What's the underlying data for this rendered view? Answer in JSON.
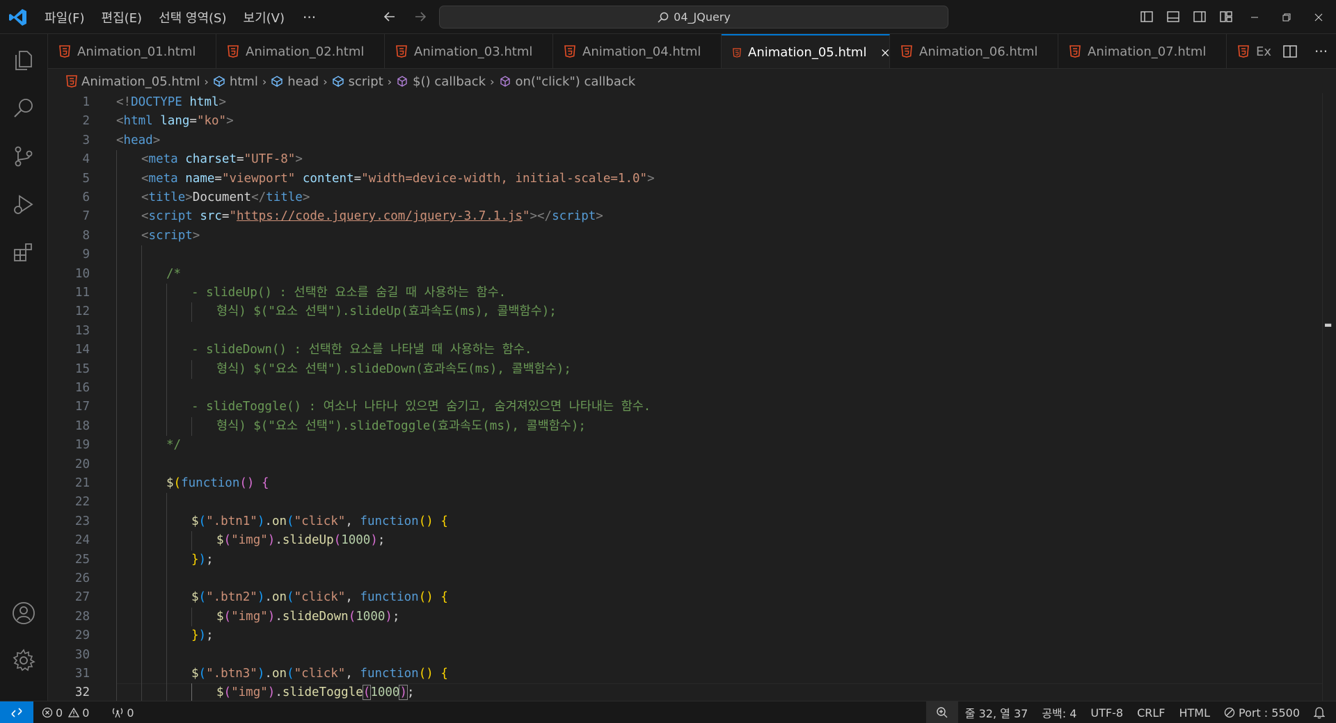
{
  "titlebar": {
    "menu": [
      "파일(F)",
      "편집(E)",
      "선택 영역(S)",
      "보기(V)"
    ],
    "more": "···",
    "search_text": "04_JQuery"
  },
  "tabs": [
    {
      "label": "Animation_01.html",
      "active": false
    },
    {
      "label": "Animation_02.html",
      "active": false
    },
    {
      "label": "Animation_03.html",
      "active": false
    },
    {
      "label": "Animation_04.html",
      "active": false
    },
    {
      "label": "Animation_05.html",
      "active": true
    },
    {
      "label": "Animation_06.html",
      "active": false
    },
    {
      "label": "Animation_07.html",
      "active": false
    }
  ],
  "tab_overflow_label": "Ex",
  "breadcrumb": [
    "Animation_05.html",
    "html",
    "head",
    "script",
    "$() callback",
    "on(\"click\") callback"
  ],
  "editor": {
    "current_line": 32,
    "lines": [
      {
        "n": 1,
        "indent": 0,
        "tokens": [
          [
            "br",
            "<!"
          ],
          [
            "tag",
            "DOCTYPE"
          ],
          [
            "txt",
            " "
          ],
          [
            "attr",
            "html"
          ],
          [
            "br",
            ">"
          ]
        ]
      },
      {
        "n": 2,
        "indent": 0,
        "tokens": [
          [
            "br",
            "<"
          ],
          [
            "tag",
            "html"
          ],
          [
            "txt",
            " "
          ],
          [
            "attr",
            "lang"
          ],
          [
            "txt",
            "="
          ],
          [
            "str",
            "\"ko\""
          ],
          [
            "br",
            ">"
          ]
        ]
      },
      {
        "n": 3,
        "indent": 0,
        "tokens": [
          [
            "br",
            "<"
          ],
          [
            "tag",
            "head"
          ],
          [
            "br",
            ">"
          ]
        ]
      },
      {
        "n": 4,
        "indent": 1,
        "tokens": [
          [
            "br",
            "<"
          ],
          [
            "tag",
            "meta"
          ],
          [
            "txt",
            " "
          ],
          [
            "attr",
            "charset"
          ],
          [
            "txt",
            "="
          ],
          [
            "str",
            "\"UTF-8\""
          ],
          [
            "br",
            ">"
          ]
        ]
      },
      {
        "n": 5,
        "indent": 1,
        "tokens": [
          [
            "br",
            "<"
          ],
          [
            "tag",
            "meta"
          ],
          [
            "txt",
            " "
          ],
          [
            "attr",
            "name"
          ],
          [
            "txt",
            "="
          ],
          [
            "str",
            "\"viewport\""
          ],
          [
            "txt",
            " "
          ],
          [
            "attr",
            "content"
          ],
          [
            "txt",
            "="
          ],
          [
            "str",
            "\"width=device-width, initial-scale=1.0\""
          ],
          [
            "br",
            ">"
          ]
        ]
      },
      {
        "n": 6,
        "indent": 1,
        "tokens": [
          [
            "br",
            "<"
          ],
          [
            "tag",
            "title"
          ],
          [
            "br",
            ">"
          ],
          [
            "txt",
            "Document"
          ],
          [
            "br",
            "</"
          ],
          [
            "tag",
            "title"
          ],
          [
            "br",
            ">"
          ]
        ]
      },
      {
        "n": 7,
        "indent": 1,
        "tokens": [
          [
            "br",
            "<"
          ],
          [
            "tag",
            "script"
          ],
          [
            "txt",
            " "
          ],
          [
            "attr",
            "src"
          ],
          [
            "txt",
            "="
          ],
          [
            "str",
            "\""
          ],
          [
            "stru",
            "https://code.jquery.com/jquery-3.7.1.js"
          ],
          [
            "str",
            "\""
          ],
          [
            "br",
            "></"
          ],
          [
            "tag",
            "script"
          ],
          [
            "br",
            ">"
          ]
        ]
      },
      {
        "n": 8,
        "indent": 1,
        "tokens": [
          [
            "br",
            "<"
          ],
          [
            "tag",
            "script"
          ],
          [
            "br",
            ">"
          ]
        ]
      },
      {
        "n": 9,
        "indent": 2,
        "tokens": []
      },
      {
        "n": 10,
        "indent": 2,
        "tokens": [
          [
            "cm",
            "/*"
          ]
        ]
      },
      {
        "n": 11,
        "indent": 3,
        "tokens": [
          [
            "cm",
            "- slideUp() : 선택한 요소를 숨길 때 사용하는 함수."
          ]
        ]
      },
      {
        "n": 12,
        "indent": 4,
        "tokens": [
          [
            "cm",
            "형식) $(\"요소 선택\").slideUp(효과속도(ms), 콜백함수);"
          ]
        ]
      },
      {
        "n": 13,
        "indent": 3,
        "tokens": []
      },
      {
        "n": 14,
        "indent": 3,
        "tokens": [
          [
            "cm",
            "- slideDown() : 선택한 요소를 나타낼 때 사용하는 함수."
          ]
        ]
      },
      {
        "n": 15,
        "indent": 4,
        "tokens": [
          [
            "cm",
            "형식) $(\"요소 선택\").slideDown(효과속도(ms), 콜백함수);"
          ]
        ]
      },
      {
        "n": 16,
        "indent": 3,
        "tokens": []
      },
      {
        "n": 17,
        "indent": 3,
        "tokens": [
          [
            "cm",
            "- slideToggle() : 여소나 나타나 있으면 숨기고, 숨겨져있으면 나타내는 함수."
          ]
        ]
      },
      {
        "n": 18,
        "indent": 4,
        "tokens": [
          [
            "cm",
            "형식) $(\"요소 선택\").slideToggle(효과속도(ms), 콜백함수);"
          ]
        ]
      },
      {
        "n": 19,
        "indent": 2,
        "tokens": [
          [
            "cm",
            "*/"
          ]
        ]
      },
      {
        "n": 20,
        "indent": 2,
        "tokens": []
      },
      {
        "n": 21,
        "indent": 2,
        "tokens": [
          [
            "fn",
            "$"
          ],
          [
            "y",
            "("
          ],
          [
            "kw",
            "function"
          ],
          [
            "p",
            "()"
          ],
          [
            "txt",
            " "
          ],
          [
            "p",
            "{"
          ]
        ]
      },
      {
        "n": 22,
        "indent": 3,
        "tokens": []
      },
      {
        "n": 23,
        "indent": 3,
        "tokens": [
          [
            "fn",
            "$"
          ],
          [
            "b",
            "("
          ],
          [
            "str",
            "\".btn1\""
          ],
          [
            "b",
            ")"
          ],
          [
            "txt",
            "."
          ],
          [
            "fn",
            "on"
          ],
          [
            "b",
            "("
          ],
          [
            "str",
            "\"click\""
          ],
          [
            "txt",
            ", "
          ],
          [
            "kw",
            "function"
          ],
          [
            "y",
            "()"
          ],
          [
            "txt",
            " "
          ],
          [
            "y",
            "{"
          ]
        ]
      },
      {
        "n": 24,
        "indent": 4,
        "tokens": [
          [
            "fn",
            "$"
          ],
          [
            "p",
            "("
          ],
          [
            "str",
            "\"img\""
          ],
          [
            "p",
            ")"
          ],
          [
            "txt",
            "."
          ],
          [
            "fn",
            "slideUp"
          ],
          [
            "p",
            "("
          ],
          [
            "num",
            "1000"
          ],
          [
            "p",
            ")"
          ],
          [
            "txt",
            ";"
          ]
        ]
      },
      {
        "n": 25,
        "indent": 3,
        "tokens": [
          [
            "y",
            "}"
          ],
          [
            "b",
            ")"
          ],
          [
            "txt",
            ";"
          ]
        ]
      },
      {
        "n": 26,
        "indent": 3,
        "tokens": []
      },
      {
        "n": 27,
        "indent": 3,
        "tokens": [
          [
            "fn",
            "$"
          ],
          [
            "b",
            "("
          ],
          [
            "str",
            "\".btn2\""
          ],
          [
            "b",
            ")"
          ],
          [
            "txt",
            "."
          ],
          [
            "fn",
            "on"
          ],
          [
            "b",
            "("
          ],
          [
            "str",
            "\"click\""
          ],
          [
            "txt",
            ", "
          ],
          [
            "kw",
            "function"
          ],
          [
            "y",
            "()"
          ],
          [
            "txt",
            " "
          ],
          [
            "y",
            "{"
          ]
        ]
      },
      {
        "n": 28,
        "indent": 4,
        "tokens": [
          [
            "fn",
            "$"
          ],
          [
            "p",
            "("
          ],
          [
            "str",
            "\"img\""
          ],
          [
            "p",
            ")"
          ],
          [
            "txt",
            "."
          ],
          [
            "fn",
            "slideDown"
          ],
          [
            "p",
            "("
          ],
          [
            "num",
            "1000"
          ],
          [
            "p",
            ")"
          ],
          [
            "txt",
            ";"
          ]
        ]
      },
      {
        "n": 29,
        "indent": 3,
        "tokens": [
          [
            "y",
            "}"
          ],
          [
            "b",
            ")"
          ],
          [
            "txt",
            ";"
          ]
        ]
      },
      {
        "n": 30,
        "indent": 3,
        "tokens": []
      },
      {
        "n": 31,
        "indent": 3,
        "tokens": [
          [
            "fn",
            "$"
          ],
          [
            "b",
            "("
          ],
          [
            "str",
            "\".btn3\""
          ],
          [
            "b",
            ")"
          ],
          [
            "txt",
            "."
          ],
          [
            "fn",
            "on"
          ],
          [
            "b",
            "("
          ],
          [
            "str",
            "\"click\""
          ],
          [
            "txt",
            ", "
          ],
          [
            "kw",
            "function"
          ],
          [
            "y",
            "()"
          ],
          [
            "txt",
            " "
          ],
          [
            "y",
            "{"
          ]
        ]
      },
      {
        "n": 32,
        "indent": 4,
        "tokens": [
          [
            "fn",
            "$"
          ],
          [
            "p",
            "("
          ],
          [
            "str",
            "\"img\""
          ],
          [
            "p",
            ")"
          ],
          [
            "txt",
            "."
          ],
          [
            "fn",
            "slideToggle"
          ],
          [
            "pm",
            "("
          ],
          [
            "num",
            "1000"
          ],
          [
            "pm",
            ")"
          ],
          [
            "txt",
            ";"
          ]
        ]
      }
    ]
  },
  "statusbar": {
    "errors": "0",
    "warnings": "0",
    "ports": "0",
    "position": "줄 32, 열 37",
    "indent": "공백: 4",
    "encoding": "UTF-8",
    "eol": "CRLF",
    "language": "HTML",
    "port": "Port : 5500"
  },
  "colors": {
    "accent": "#0078d4",
    "html_icon": "#e44d26"
  },
  "icons": [
    "vscode-logo-icon",
    "arrow-left-icon",
    "arrow-right-icon",
    "search-icon",
    "explorer-icon",
    "source-control-icon",
    "run-debug-icon",
    "extensions-icon",
    "account-icon",
    "settings-gear-icon",
    "html5-file-icon",
    "close-icon",
    "split-editor-icon",
    "more-actions-icon",
    "symbol-element-icon",
    "symbol-method-icon",
    "remote-icon",
    "error-icon",
    "warning-icon",
    "broadcast-icon",
    "zoom-icon",
    "no-port-icon",
    "bell-icon"
  ]
}
